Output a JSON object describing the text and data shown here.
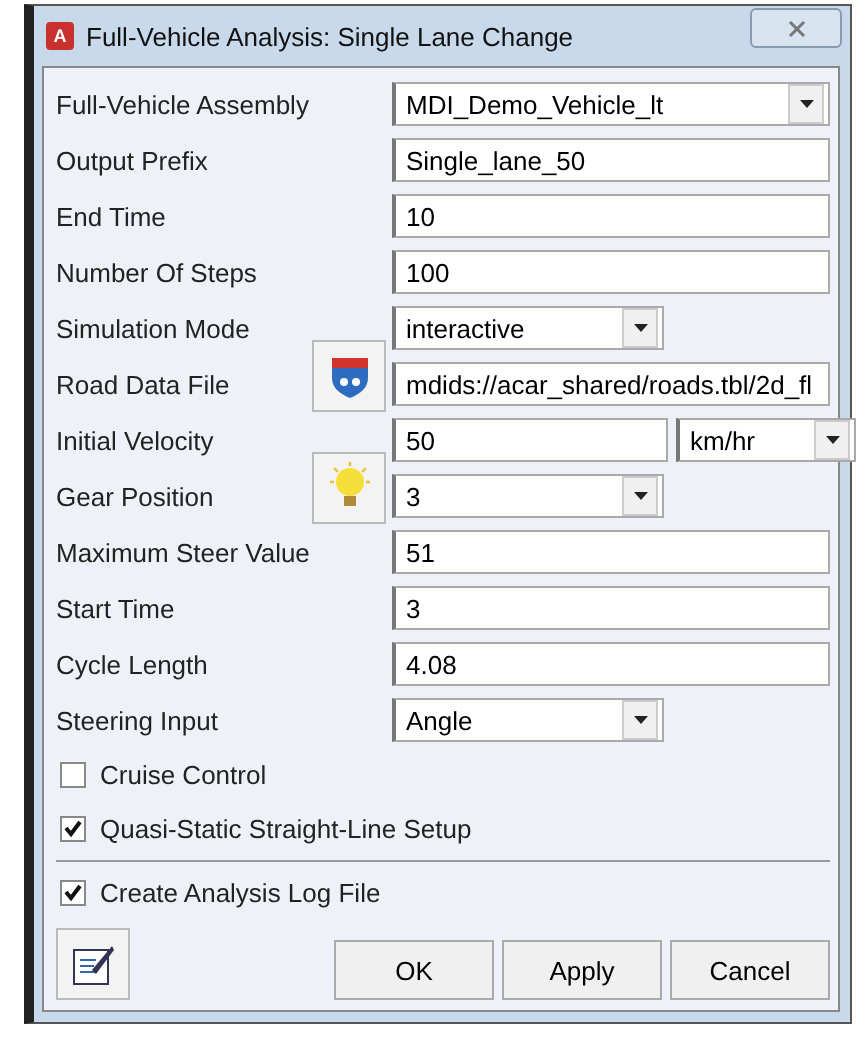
{
  "window": {
    "title": "Full-Vehicle Analysis: Single Lane Change",
    "app_badge": "A"
  },
  "rows": [
    {
      "kind": "combo",
      "label": "Full-Vehicle Assembly",
      "value": "MDI_Demo_Vehicle_lt"
    },
    {
      "kind": "text",
      "label": "Output Prefix",
      "value": "Single_lane_50"
    },
    {
      "kind": "text",
      "label": "End Time",
      "value": "10"
    },
    {
      "kind": "text",
      "label": "Number Of Steps",
      "value": "100"
    },
    {
      "kind": "short-combo",
      "label": "Simulation Mode",
      "value": "interactive"
    },
    {
      "kind": "road-file",
      "label": "Road Data File",
      "value": "mdids://acar_shared/roads.tbl/2d_fl"
    },
    {
      "kind": "unit-text",
      "label": "Initial Velocity",
      "value": "50",
      "unit": "km/hr"
    },
    {
      "kind": "hint-combo",
      "label": "Gear Position",
      "value": "3"
    },
    {
      "kind": "text",
      "label": "Maximum Steer Value",
      "value": "51"
    },
    {
      "kind": "text",
      "label": "Start Time",
      "value": "3"
    },
    {
      "kind": "text",
      "label": "Cycle Length",
      "value": "4.08"
    },
    {
      "kind": "short-combo",
      "label": "Steering Input",
      "value": "Angle"
    }
  ],
  "options": [
    {
      "label": "Cruise Control",
      "checked": false
    },
    {
      "label": "Quasi-Static Straight-Line Setup",
      "checked": true
    }
  ],
  "log_option": {
    "label": "Create Analysis Log File",
    "checked": true
  },
  "buttons": [
    "OK",
    "Apply",
    "Cancel"
  ]
}
